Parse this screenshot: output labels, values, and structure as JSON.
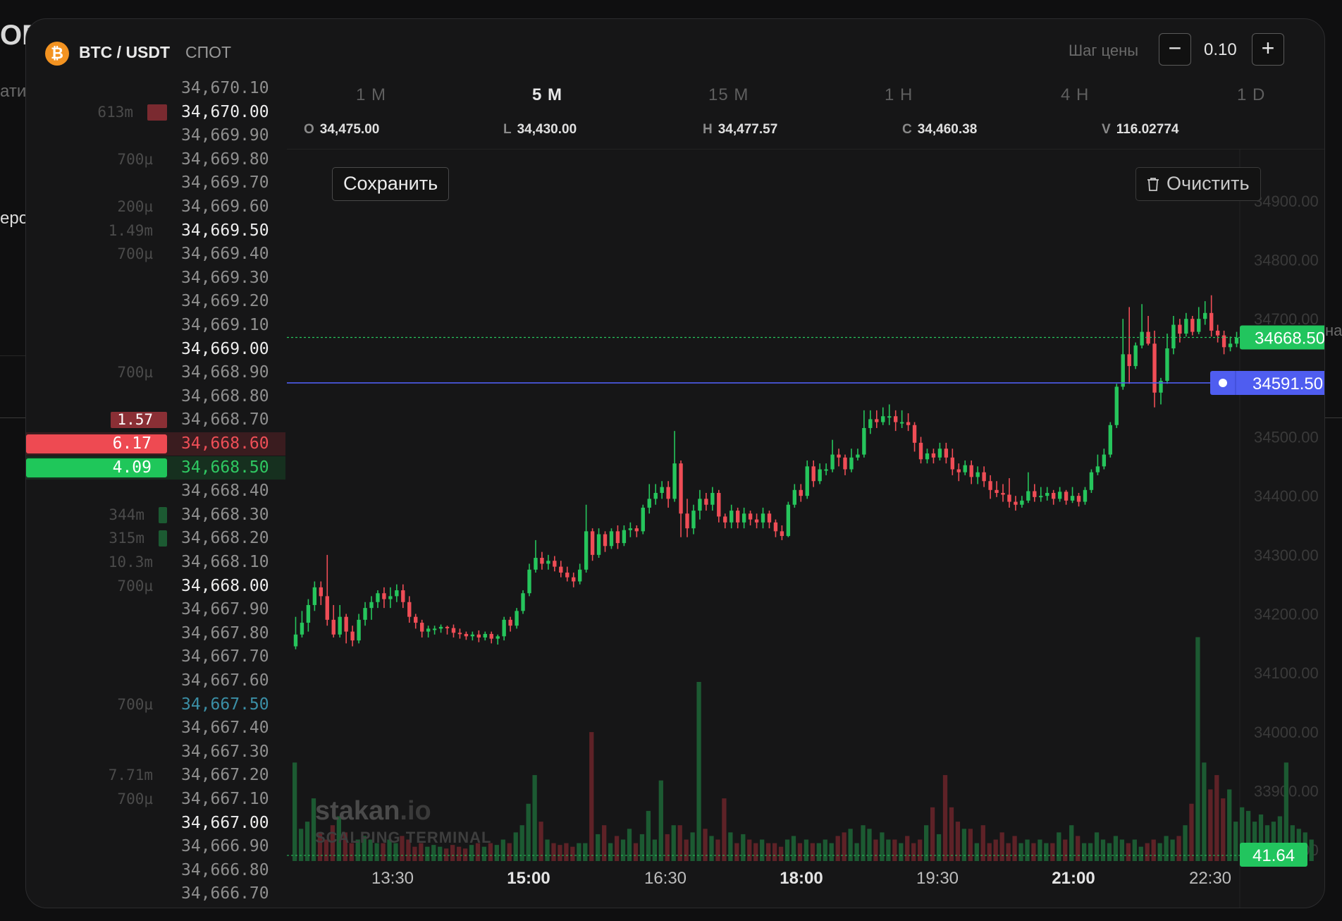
{
  "background": {
    "edge_texts": [
      "ОВ",
      "ати",
      "еро",
      "на"
    ]
  },
  "header": {
    "coin_icon": "bitcoin-icon",
    "coin_symbol": "₿",
    "pair": "BTC / USDT",
    "market": "СПОТ",
    "step_label": "Шаг цены",
    "step_minus": "−",
    "step_value": "0.10",
    "step_plus": "+"
  },
  "orderbook": {
    "rows": [
      {
        "price": "34,670.10",
        "vol": "",
        "style": "normal"
      },
      {
        "price": "34,670.00",
        "vol": "613m",
        "style": "bold",
        "bar": "ask",
        "barw": 28
      },
      {
        "price": "34,669.90",
        "vol": "",
        "style": "normal"
      },
      {
        "price": "34,669.80",
        "vol": "700µ",
        "style": "normal"
      },
      {
        "price": "34,669.70",
        "vol": "",
        "style": "normal"
      },
      {
        "price": "34,669.60",
        "vol": "200µ",
        "style": "normal"
      },
      {
        "price": "34,669.50",
        "vol": "1.49m",
        "style": "bold"
      },
      {
        "price": "34,669.40",
        "vol": "700µ",
        "style": "normal"
      },
      {
        "price": "34,669.30",
        "vol": "",
        "style": "normal"
      },
      {
        "price": "34,669.20",
        "vol": "",
        "style": "normal"
      },
      {
        "price": "34,669.10",
        "vol": "",
        "style": "normal"
      },
      {
        "price": "34,669.00",
        "vol": "",
        "style": "bold"
      },
      {
        "price": "34,668.90",
        "vol": "700µ",
        "style": "normal"
      },
      {
        "price": "34,668.80",
        "vol": "",
        "style": "normal"
      },
      {
        "price": "34,668.70",
        "vol": "1.57",
        "style": "normal",
        "bar": "ask-mid",
        "barw": 80
      },
      {
        "price": "34,668.60",
        "vol": "6.17",
        "style": "ask",
        "bar": "ask-best"
      },
      {
        "price": "34,668.50",
        "vol": "4.09",
        "style": "bid",
        "bar": "bid-best"
      },
      {
        "price": "34,668.40",
        "vol": "",
        "style": "normal"
      },
      {
        "price": "34,668.30",
        "vol": "344m",
        "style": "normal",
        "bar": "bid",
        "barw": 12
      },
      {
        "price": "34,668.20",
        "vol": "315m",
        "style": "normal",
        "bar": "bid",
        "barw": 12
      },
      {
        "price": "34,668.10",
        "vol": "10.3m",
        "style": "normal"
      },
      {
        "price": "34,668.00",
        "vol": "700µ",
        "style": "bold"
      },
      {
        "price": "34,667.90",
        "vol": "",
        "style": "normal"
      },
      {
        "price": "34,667.80",
        "vol": "",
        "style": "normal"
      },
      {
        "price": "34,667.70",
        "vol": "",
        "style": "normal"
      },
      {
        "price": "34,667.60",
        "vol": "",
        "style": "normal"
      },
      {
        "price": "34,667.50",
        "vol": "700µ",
        "style": "mark"
      },
      {
        "price": "34,667.40",
        "vol": "",
        "style": "normal"
      },
      {
        "price": "34,667.30",
        "vol": "",
        "style": "normal"
      },
      {
        "price": "34,667.20",
        "vol": "7.71m",
        "style": "normal"
      },
      {
        "price": "34,667.10",
        "vol": "700µ",
        "style": "normal"
      },
      {
        "price": "34,667.00",
        "vol": "",
        "style": "bold"
      },
      {
        "price": "34,666.90",
        "vol": "",
        "style": "normal"
      },
      {
        "price": "34,666.80",
        "vol": "",
        "style": "normal"
      },
      {
        "price": "34,666.70",
        "vol": "",
        "style": "normal"
      }
    ]
  },
  "chart": {
    "timeframes": [
      {
        "label": "1 M",
        "active": false
      },
      {
        "label": "5 M",
        "active": true
      },
      {
        "label": "15 M",
        "active": false
      },
      {
        "label": "1 H",
        "active": false
      },
      {
        "label": "4 H",
        "active": false
      },
      {
        "label": "1 D",
        "active": false
      }
    ],
    "ohlc": {
      "o_key": "O",
      "o": "34,475.00",
      "l_key": "L",
      "l": "34,430.00",
      "h_key": "H",
      "h": "34,477.57",
      "c_key": "C",
      "c": "34,460.38",
      "v_key": "V",
      "v": "116.02774"
    },
    "save_label": "Сохранить",
    "clear_label": "Очистить",
    "clear_icon": "trash-icon",
    "watermark_brand": "stakan",
    "watermark_tld": ".io",
    "watermark_sub": "SCALPING TERMINAL",
    "colors": {
      "up": "#26c55c",
      "down": "#ef4d56",
      "up_vol": "#1c5a32",
      "down_vol": "#5e2227",
      "order_line": "#4f5df0",
      "last_line": "#26c55c"
    }
  },
  "chart_data": {
    "type": "candlestick",
    "title": "",
    "y_axis": {
      "min": 33750,
      "max": 34950,
      "ticks": [
        "34900.00",
        "34800.00",
        "34700.00",
        "34600.00",
        "34500.00",
        "34400.00",
        "34300.00",
        "34200.00",
        "34100.00",
        "34000.00",
        "33900.00",
        "33800.00"
      ]
    },
    "x_axis": {
      "ticks": [
        {
          "label": "13:30",
          "bold": false
        },
        {
          "label": "15:00",
          "bold": true
        },
        {
          "label": "16:30",
          "bold": false
        },
        {
          "label": "18:00",
          "bold": true
        },
        {
          "label": "19:30",
          "bold": false
        },
        {
          "label": "21:00",
          "bold": true
        },
        {
          "label": "22:30",
          "bold": false
        }
      ]
    },
    "last_price": "34668.50",
    "order_price": "34591.50",
    "last_volume": "41.64",
    "candles": [
      [
        34145,
        34165,
        34140,
        34195
      ],
      [
        34165,
        34185,
        34160,
        34205
      ],
      [
        34185,
        34215,
        34170,
        34225
      ],
      [
        34215,
        34245,
        34205,
        34255
      ],
      [
        34245,
        34230,
        34215,
        34255
      ],
      [
        34230,
        34190,
        34180,
        34300
      ],
      [
        34190,
        34165,
        34160,
        34215
      ],
      [
        34165,
        34195,
        34160,
        34215
      ],
      [
        34195,
        34170,
        34150,
        34200
      ],
      [
        34170,
        34155,
        34145,
        34180
      ],
      [
        34155,
        34190,
        34150,
        34200
      ],
      [
        34190,
        34210,
        34180,
        34220
      ],
      [
        34210,
        34220,
        34190,
        34230
      ],
      [
        34220,
        34235,
        34210,
        34240
      ],
      [
        34235,
        34225,
        34210,
        34245
      ],
      [
        34225,
        34230,
        34210,
        34245
      ],
      [
        34230,
        34240,
        34220,
        34250
      ],
      [
        34240,
        34220,
        34210,
        34250
      ],
      [
        34220,
        34195,
        34185,
        34230
      ],
      [
        34195,
        34185,
        34175,
        34200
      ],
      [
        34185,
        34170,
        34160,
        34190
      ],
      [
        34170,
        34175,
        34160,
        34180
      ],
      [
        34175,
        34175,
        34165,
        34180
      ],
      [
        34175,
        34178,
        34168,
        34182
      ],
      [
        34178,
        34176,
        34165,
        34180
      ],
      [
        34176,
        34168,
        34160,
        34182
      ],
      [
        34168,
        34166,
        34158,
        34175
      ],
      [
        34166,
        34162,
        34156,
        34170
      ],
      [
        34162,
        34165,
        34155,
        34170
      ],
      [
        34165,
        34160,
        34152,
        34172
      ],
      [
        34160,
        34166,
        34155,
        34170
      ],
      [
        34166,
        34158,
        34150,
        34170
      ],
      [
        34158,
        34162,
        34148,
        34165
      ],
      [
        34162,
        34190,
        34155,
        34195
      ],
      [
        34190,
        34180,
        34170,
        34195
      ],
      [
        34180,
        34205,
        34175,
        34210
      ],
      [
        34205,
        34235,
        34200,
        34240
      ],
      [
        34235,
        34275,
        34230,
        34285
      ],
      [
        34275,
        34295,
        34270,
        34325
      ],
      [
        34295,
        34285,
        34275,
        34305
      ],
      [
        34285,
        34290,
        34275,
        34300
      ],
      [
        34290,
        34280,
        34272,
        34298
      ],
      [
        34280,
        34270,
        34262,
        34290
      ],
      [
        34270,
        34262,
        34255,
        34280
      ],
      [
        34262,
        34255,
        34245,
        34270
      ],
      [
        34255,
        34275,
        34250,
        34285
      ],
      [
        34275,
        34340,
        34270,
        34385
      ],
      [
        34340,
        34300,
        34290,
        34345
      ],
      [
        34300,
        34335,
        34295,
        34345
      ],
      [
        34335,
        34315,
        34305,
        34340
      ],
      [
        34315,
        34340,
        34310,
        34345
      ],
      [
        34340,
        34320,
        34310,
        34350
      ],
      [
        34320,
        34342,
        34315,
        34350
      ],
      [
        34342,
        34345,
        34330,
        34355
      ],
      [
        34345,
        34340,
        34330,
        34350
      ],
      [
        34340,
        34380,
        34335,
        34385
      ],
      [
        34380,
        34395,
        34370,
        34420
      ],
      [
        34395,
        34405,
        34385,
        34420
      ],
      [
        34405,
        34415,
        34395,
        34425
      ],
      [
        34415,
        34395,
        34380,
        34425
      ],
      [
        34395,
        34455,
        34390,
        34510
      ],
      [
        34455,
        34370,
        34330,
        34460
      ],
      [
        34370,
        34345,
        34330,
        34395
      ],
      [
        34345,
        34375,
        34335,
        34385
      ],
      [
        34375,
        34395,
        34360,
        34410
      ],
      [
        34395,
        34385,
        34375,
        34405
      ],
      [
        34385,
        34405,
        34375,
        34415
      ],
      [
        34405,
        34365,
        34355,
        34410
      ],
      [
        34365,
        34355,
        34345,
        34370
      ],
      [
        34355,
        34375,
        34345,
        34385
      ],
      [
        34375,
        34355,
        34345,
        34380
      ],
      [
        34355,
        34370,
        34345,
        34380
      ],
      [
        34370,
        34360,
        34350,
        34375
      ],
      [
        34360,
        34355,
        34345,
        34370
      ],
      [
        34355,
        34370,
        34345,
        34380
      ],
      [
        34370,
        34355,
        34345,
        34375
      ],
      [
        34355,
        34340,
        34330,
        34360
      ],
      [
        34340,
        34332,
        34325,
        34350
      ],
      [
        34332,
        34385,
        34330,
        34390
      ],
      [
        34385,
        34410,
        34380,
        34420
      ],
      [
        34410,
        34400,
        34390,
        34420
      ],
      [
        34400,
        34450,
        34395,
        34460
      ],
      [
        34450,
        34425,
        34415,
        34460
      ],
      [
        34425,
        34445,
        34420,
        34455
      ],
      [
        34445,
        34445,
        34435,
        34455
      ],
      [
        34445,
        34470,
        34440,
        34495
      ],
      [
        34470,
        34465,
        34450,
        34480
      ],
      [
        34465,
        34445,
        34435,
        34470
      ],
      [
        34445,
        34465,
        34440,
        34480
      ],
      [
        34465,
        34470,
        34460,
        34480
      ],
      [
        34470,
        34515,
        34465,
        34545
      ],
      [
        34515,
        34530,
        34505,
        34545
      ],
      [
        34530,
        34525,
        34515,
        34545
      ],
      [
        34525,
        34535,
        34520,
        34550
      ],
      [
        34535,
        34535,
        34520,
        34555
      ],
      [
        34535,
        34525,
        34510,
        34545
      ],
      [
        34525,
        34525,
        34515,
        34545
      ],
      [
        34525,
        34520,
        34510,
        34540
      ],
      [
        34520,
        34490,
        34475,
        34525
      ],
      [
        34490,
        34462,
        34455,
        34500
      ],
      [
        34462,
        34472,
        34455,
        34480
      ],
      [
        34472,
        34465,
        34455,
        34480
      ],
      [
        34465,
        34480,
        34460,
        34490
      ],
      [
        34480,
        34465,
        34455,
        34490
      ],
      [
        34465,
        34445,
        34435,
        34480
      ],
      [
        34445,
        34440,
        34425,
        34455
      ],
      [
        34440,
        34452,
        34435,
        34460
      ],
      [
        34452,
        34432,
        34420,
        34460
      ],
      [
        34432,
        34440,
        34420,
        34450
      ],
      [
        34440,
        34425,
        34415,
        34450
      ],
      [
        34425,
        34410,
        34395,
        34435
      ],
      [
        34410,
        34405,
        34398,
        34425
      ],
      [
        34405,
        34402,
        34390,
        34420
      ],
      [
        34402,
        34390,
        34380,
        34430
      ],
      [
        34390,
        34385,
        34375,
        34400
      ],
      [
        34385,
        34392,
        34380,
        34400
      ],
      [
        34392,
        34408,
        34388,
        34440
      ],
      [
        34408,
        34398,
        34390,
        34420
      ],
      [
        34398,
        34400,
        34390,
        34415
      ],
      [
        34400,
        34405,
        34392,
        34415
      ],
      [
        34405,
        34395,
        34385,
        34410
      ],
      [
        34395,
        34407,
        34390,
        34415
      ],
      [
        34407,
        34392,
        34385,
        34410
      ],
      [
        34392,
        34400,
        34388,
        34415
      ],
      [
        34400,
        34390,
        34382,
        34405
      ],
      [
        34390,
        34410,
        34385,
        34415
      ],
      [
        34410,
        34440,
        34405,
        34445
      ],
      [
        34440,
        34450,
        34435,
        34470
      ],
      [
        34450,
        34470,
        34445,
        34480
      ],
      [
        34470,
        34520,
        34465,
        34525
      ],
      [
        34520,
        34585,
        34515,
        34590
      ],
      [
        34585,
        34640,
        34580,
        34700
      ],
      [
        34640,
        34620,
        34590,
        34720
      ],
      [
        34620,
        34655,
        34615,
        34660
      ],
      [
        34655,
        34678,
        34650,
        34725
      ],
      [
        34678,
        34658,
        34655,
        34705
      ],
      [
        34658,
        34575,
        34550,
        34680
      ],
      [
        34575,
        34595,
        34555,
        34600
      ],
      [
        34595,
        34650,
        34590,
        34675
      ],
      [
        34650,
        34690,
        34640,
        34705
      ],
      [
        34690,
        34675,
        34660,
        34700
      ],
      [
        34675,
        34700,
        34670,
        34710
      ],
      [
        34700,
        34678,
        34672,
        34705
      ],
      [
        34678,
        34700,
        34674,
        34720
      ],
      [
        34700,
        34710,
        34690,
        34730
      ],
      [
        34710,
        34680,
        34670,
        34740
      ],
      [
        34680,
        34672,
        34660,
        34690
      ],
      [
        34672,
        34652,
        34640,
        34680
      ],
      [
        34652,
        34658,
        34645,
        34670
      ],
      [
        34658,
        34668,
        34652,
        34678
      ]
    ],
    "volume_ratio": [
      0.55,
      0.18,
      0.22,
      0.35,
      0.16,
      0.12,
      0.2,
      0.25,
      0.16,
      0.1,
      0.12,
      0.14,
      0.12,
      0.1,
      0.1,
      0.12,
      0.1,
      0.14,
      0.12,
      0.08,
      0.1,
      0.08,
      0.09,
      0.08,
      0.07,
      0.09,
      0.08,
      0.07,
      0.09,
      0.1,
      0.08,
      0.1,
      0.09,
      0.12,
      0.1,
      0.16,
      0.2,
      0.32,
      0.48,
      0.22,
      0.12,
      0.1,
      0.09,
      0.1,
      0.08,
      0.1,
      0.1,
      0.72,
      0.15,
      0.2,
      0.1,
      0.14,
      0.12,
      0.18,
      0.1,
      0.15,
      0.28,
      0.12,
      0.45,
      0.15,
      0.2,
      0.2,
      0.12,
      0.16,
      1.0,
      0.18,
      0.14,
      0.12,
      0.35,
      0.16,
      0.1,
      0.15,
      0.12,
      0.1,
      0.12,
      0.1,
      0.1,
      0.08,
      0.12,
      0.14,
      0.1,
      0.12,
      0.1,
      0.1,
      0.12,
      0.1,
      0.14,
      0.16,
      0.18,
      0.1,
      0.2,
      0.18,
      0.12,
      0.16,
      0.12,
      0.12,
      0.1,
      0.14,
      0.1,
      0.12,
      0.2,
      0.3,
      0.15,
      0.48,
      0.3,
      0.22,
      0.18,
      0.18,
      0.1,
      0.2,
      0.1,
      0.12,
      0.16,
      0.1,
      0.14,
      0.1,
      0.12,
      0.1,
      0.12,
      0.1,
      0.1,
      0.16,
      0.12,
      0.2,
      0.14,
      0.1,
      0.1,
      0.16,
      0.12,
      0.1,
      0.14,
      0.12,
      0.1,
      0.12,
      0.08,
      0.1,
      0.12,
      0.1,
      0.14,
      0.12,
      0.14,
      0.2,
      0.32,
      1.25,
      0.55,
      0.4,
      0.48,
      0.35,
      0.4,
      0.22,
      0.3,
      0.28,
      0.22,
      0.26,
      0.2,
      0.22,
      0.25,
      0.55,
      0.2,
      0.18,
      0.16,
      0.12
    ]
  }
}
